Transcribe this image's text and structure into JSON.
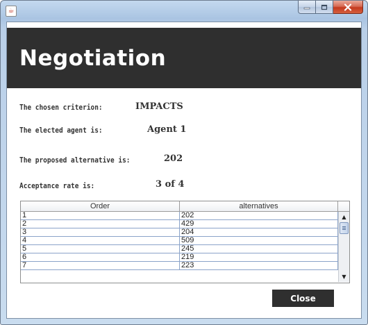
{
  "window": {
    "icon": "java-icon",
    "icon_glyph": "☕",
    "minimize_icon": "minimize-icon",
    "maximize_icon": "maximize-icon",
    "close_icon": "close-icon"
  },
  "header": {
    "title": "Negotiation"
  },
  "info": {
    "criterion_label": "The chosen criterion:",
    "criterion_value": "IMPACTS",
    "agent_label": "The elected agent is:",
    "agent_value": "Agent 1",
    "alternative_label": "The proposed alternative is:",
    "alternative_value": "202",
    "rate_label": "Acceptance rate is:",
    "rate_value": "3 of 4"
  },
  "table": {
    "columns": [
      "Order",
      "alternatives"
    ],
    "rows": [
      [
        "1",
        "202"
      ],
      [
        "2",
        "429"
      ],
      [
        "3",
        "204"
      ],
      [
        "4",
        "509"
      ],
      [
        "5",
        "245"
      ],
      [
        "6",
        "219"
      ],
      [
        "7",
        "223"
      ]
    ],
    "scroll": {
      "up_glyph": "▲",
      "down_glyph": "▼"
    }
  },
  "buttons": {
    "close_label": "Close"
  },
  "colors": {
    "header_bg": "#2f2f2f",
    "grid_line": "#8ba3c9"
  }
}
